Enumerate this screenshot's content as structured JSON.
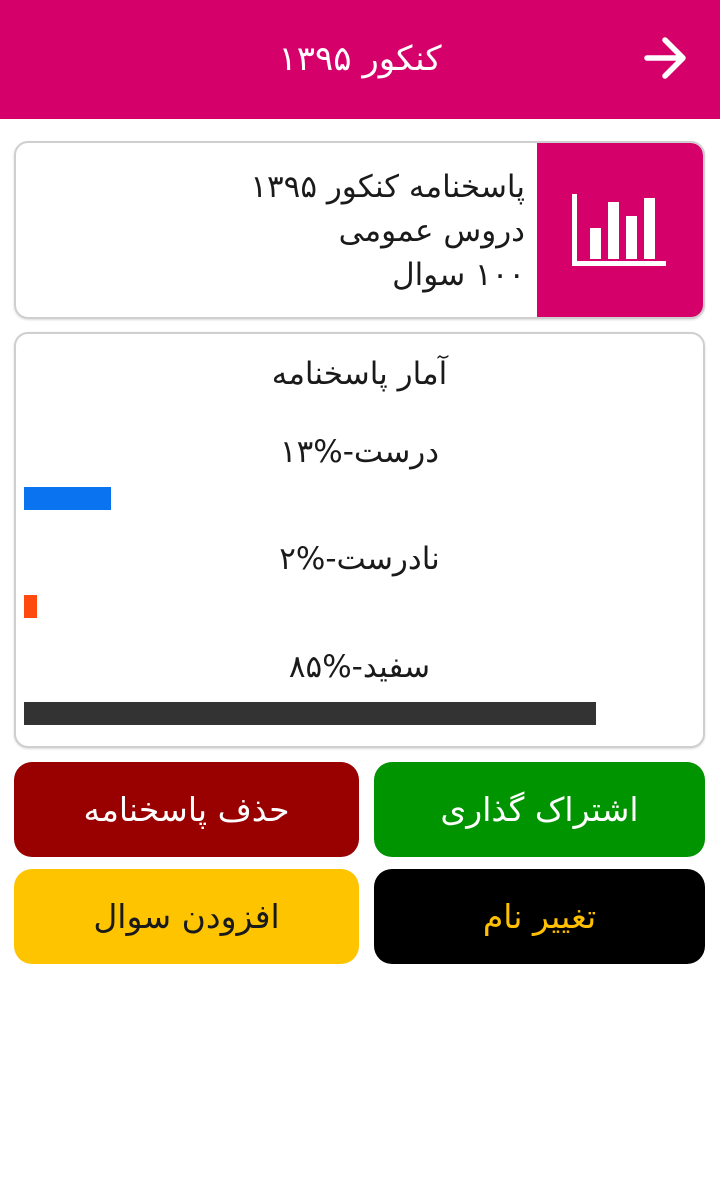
{
  "appbar": {
    "title": "کنکور ۱۳۹۵",
    "back_icon": "arrow-right-icon",
    "background": "#d6006b"
  },
  "info": {
    "icon": "bar-chart-icon",
    "line1": "پاسخنامه کنکور ۱۳۹۵",
    "line2": "دروس عمومی",
    "line3": "۱۰۰ سوال"
  },
  "stats": {
    "title": "آمار پاسخنامه",
    "items": [
      {
        "label": "درست-%۱۳",
        "percent": 13,
        "color": "#0a73f0"
      },
      {
        "label": "نادرست-%۲",
        "percent": 2,
        "color": "#ff4a0f"
      },
      {
        "label": "سفید-%۸۵",
        "percent": 85,
        "color": "#333333"
      }
    ]
  },
  "buttons": {
    "share": {
      "label": "اشتراک گذاری",
      "bg": "#009400",
      "fg": "#ffffff"
    },
    "delete": {
      "label": "حذف پاسخنامه",
      "bg": "#990000",
      "fg": "#ffffff"
    },
    "rename": {
      "label": "تغییر نام",
      "bg": "#000000",
      "fg": "#ffc000"
    },
    "add_question": {
      "label": "افزودن سوال",
      "bg": "#ffc400",
      "fg": "#1a1a1a"
    }
  }
}
